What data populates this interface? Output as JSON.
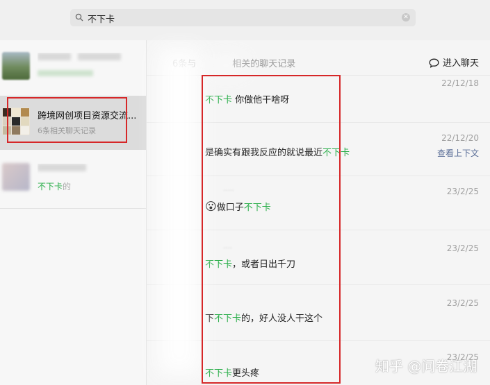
{
  "search": {
    "value": "不下卡",
    "icon": "search-icon",
    "clear_icon": "close-circle-icon"
  },
  "conversations": [
    {
      "title": "",
      "subtitle": "",
      "blurred": true
    },
    {
      "title": "跨境网创项目资源交流...",
      "subtitle": "6条相关聊天记录",
      "blurred": false
    },
    {
      "title": "",
      "subtitle_highlight": "不下卡",
      "subtitle_rest": "的",
      "blurred": true
    }
  ],
  "results_header": {
    "count_text": "6条与",
    "count_suffix": "相关的聊天记录",
    "enter_chat": "进入聊天",
    "enter_chat_icon": "chat-bubble-icon"
  },
  "messages": [
    {
      "date": "22/12/18",
      "pre": "",
      "hl": "不下卡",
      "post": " 你做他干啥呀"
    },
    {
      "date": "22/12/20",
      "pre": "是确实有跟我反应的就说最近",
      "hl": "不下卡",
      "post": "",
      "context_link": "查看上下文"
    },
    {
      "date": "23/2/25",
      "emoji": "😮",
      "pre": "做口子",
      "hl": "不下卡",
      "post": ""
    },
    {
      "date": "23/2/25",
      "pre": "",
      "hl": "不下卡",
      "post": "，或者日出千刀"
    },
    {
      "date": "23/2/25",
      "pre": "下",
      "hl": "不下卡",
      "post": "的，好人没人干这个"
    },
    {
      "date": "23/2/25",
      "pre": "",
      "hl": "不下卡",
      "post": "更头疼"
    }
  ],
  "watermark": "知乎 @问卷江湖",
  "colors": {
    "highlight": "#2aae4a",
    "annotation_box": "#d62728",
    "link": "#576b95"
  }
}
